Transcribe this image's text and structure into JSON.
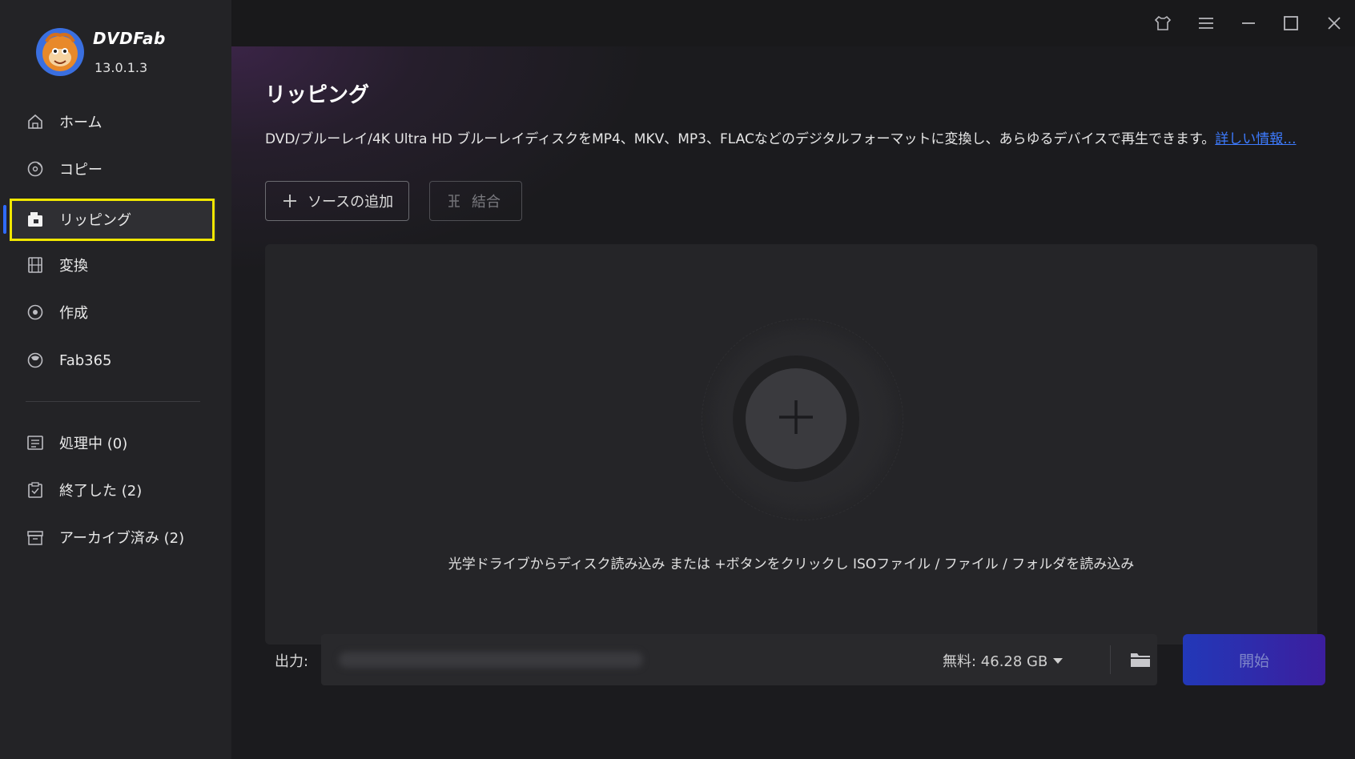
{
  "app": {
    "brand": "DVDFab",
    "version": "13.0.1.3"
  },
  "sidebar": {
    "items": [
      {
        "label": "ホーム",
        "icon": "home-icon"
      },
      {
        "label": "コピー",
        "icon": "copy-disc-icon"
      },
      {
        "label": "リッピング",
        "icon": "ripper-icon",
        "active": true
      },
      {
        "label": "変換",
        "icon": "film-icon"
      },
      {
        "label": "作成",
        "icon": "creator-disc-icon"
      },
      {
        "label": "Fab365",
        "icon": "fab365-icon"
      }
    ],
    "tasks": [
      {
        "label": "処理中 (0)",
        "icon": "processing-list-icon"
      },
      {
        "label": "終了した (2)",
        "icon": "finished-clipboard-icon"
      },
      {
        "label": "アーカイブ済み (2)",
        "icon": "archive-box-icon"
      }
    ]
  },
  "titlebar": {
    "icons": [
      "skin-shirt-icon",
      "menu-icon",
      "minimize-icon",
      "maximize-icon",
      "close-icon"
    ]
  },
  "main": {
    "title": "リッピング",
    "description": "DVD/ブルーレイ/4K Ultra HD ブルーレイディスクをMP4、MKV、MP3、FLACなどのデジタルフォーマットに変換し、あらゆるデバイスで再生できます。",
    "more_link": "詳しい情報...",
    "add_source_label": "ソースの追加",
    "merge_label": "結合",
    "drop_hint": "光学ドライブからディスク読み込み または +ボタンをクリックし ISOファイル / ファイル / フォルダを読み込み"
  },
  "output": {
    "label": "出力:",
    "free_space": "無料:  46.28 GB",
    "start_label": "開始"
  },
  "colors": {
    "accent_blue": "#2f6bff",
    "link": "#3d7bff",
    "highlight": "#f0e600",
    "start_gradient_from": "#2238b8",
    "start_gradient_to": "#3c1e9e"
  }
}
